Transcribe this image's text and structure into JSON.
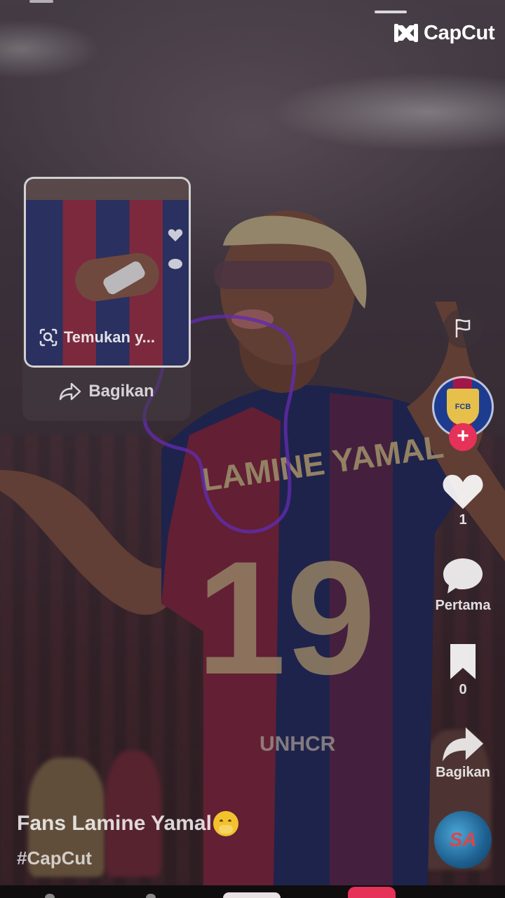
{
  "app": {
    "brand": "CapCut"
  },
  "share_card": {
    "thumbnail_search_text": "Temukan y...",
    "share_label": "Bagikan"
  },
  "rail": {
    "like_count": "1",
    "comment_label": "Pertama",
    "save_count": "0",
    "share_label": "Bagikan",
    "avatar_badge": "FCB"
  },
  "caption": {
    "title": "Fans Lamine Yamal",
    "hashtag": "#CapCut"
  },
  "colors": {
    "accent": "#e63159",
    "text": "#ffffff"
  },
  "icons": [
    "flag-icon",
    "heart-icon",
    "comment-icon",
    "bookmark-icon",
    "share-icon",
    "search-scan-icon",
    "capcut-logo-icon"
  ]
}
